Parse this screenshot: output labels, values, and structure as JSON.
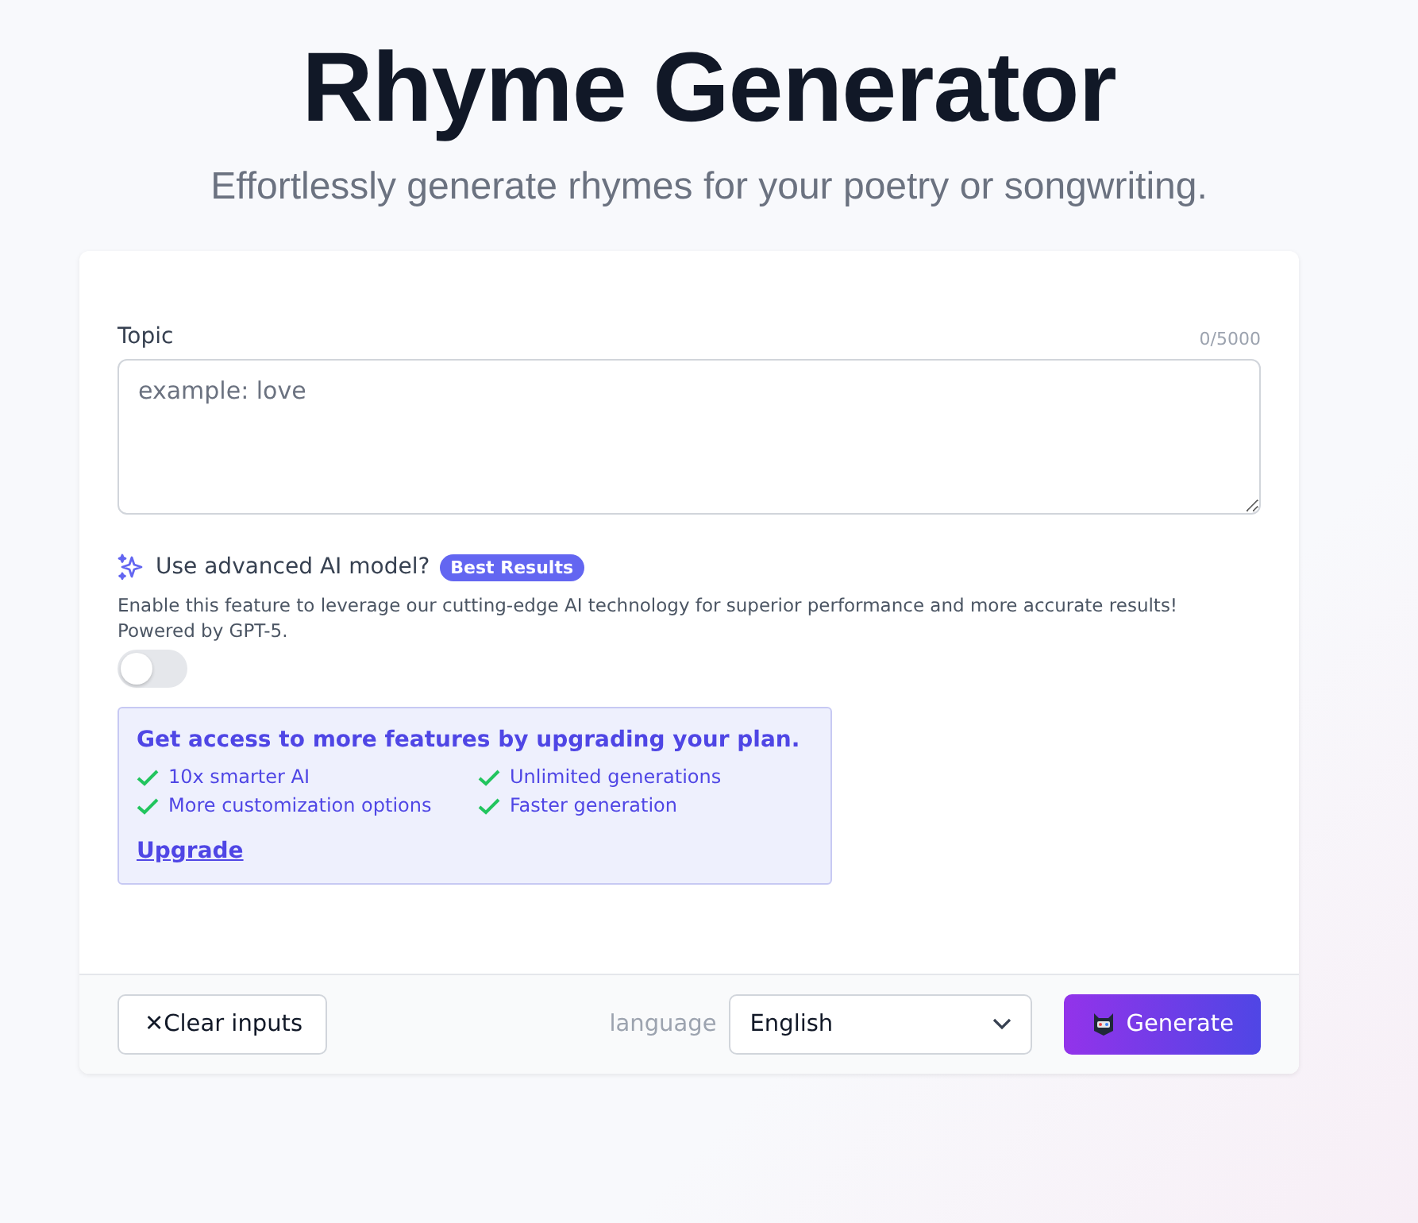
{
  "header": {
    "title": "Rhyme Generator",
    "subtitle": "Effortlessly generate rhymes for your poetry or songwriting."
  },
  "topic": {
    "label": "Topic",
    "counter": "0/5000",
    "placeholder": "example: love"
  },
  "advanced": {
    "label": "Use advanced AI model?",
    "badge": "Best Results",
    "description": "Enable this feature to leverage our cutting-edge AI technology for superior performance and more accurate results! Powered by GPT-5.",
    "on": false
  },
  "upgrade": {
    "title": "Get access to more features by upgrading your plan.",
    "features": [
      "10x smarter AI",
      "Unlimited generations",
      "More customization options",
      "Faster generation"
    ],
    "link": "Upgrade"
  },
  "footer": {
    "clear_icon": "✕",
    "clear_label": "Clear inputs",
    "language_label": "language",
    "language_value": "English",
    "generate_label": "Generate"
  }
}
